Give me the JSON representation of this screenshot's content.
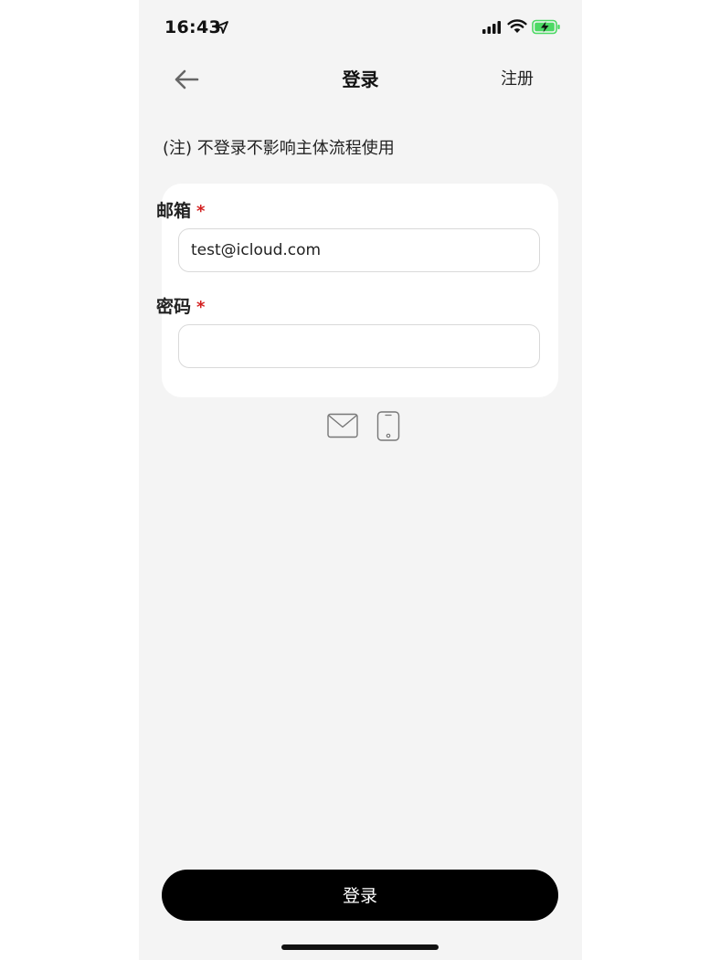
{
  "status_bar": {
    "time": "16:43",
    "icons": [
      "location-arrow-icon",
      "cellular-signal-icon",
      "wifi-icon",
      "battery-charging-icon"
    ],
    "battery_color": "#4cd964"
  },
  "nav": {
    "back_icon": "arrow-left-icon",
    "title": "登录",
    "register_label": "注册"
  },
  "note": "(注) 不登录不影响主体流程使用",
  "form": {
    "email": {
      "label": "邮箱",
      "required_mark": "*",
      "value": "test@icloud.com"
    },
    "password": {
      "label": "密码",
      "required_mark": "*",
      "value": ""
    }
  },
  "login_methods": [
    "mail-icon",
    "mobile-phone-icon"
  ],
  "login_button": "登录",
  "colors": {
    "background": "#f4f4f4",
    "card": "#ffffff",
    "required": "#d32020",
    "button": "#000000"
  }
}
